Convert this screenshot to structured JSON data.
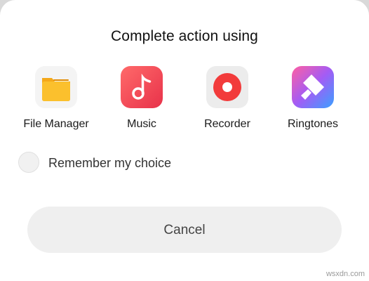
{
  "dialog": {
    "title": "Complete action using",
    "apps": [
      {
        "label": "File Manager",
        "icon": "folder-icon",
        "color": "#f6b81f"
      },
      {
        "label": "Music",
        "icon": "music-note-icon",
        "color": "#f04848"
      },
      {
        "label": "Recorder",
        "icon": "record-icon",
        "color": "#f03a3a"
      },
      {
        "label": "Ringtones",
        "icon": "ringtone-brush-icon",
        "color": "#a45cf0"
      }
    ],
    "remember_label": "Remember my choice",
    "remember_checked": false,
    "cancel_label": "Cancel"
  },
  "watermark": "wsxdn.com"
}
